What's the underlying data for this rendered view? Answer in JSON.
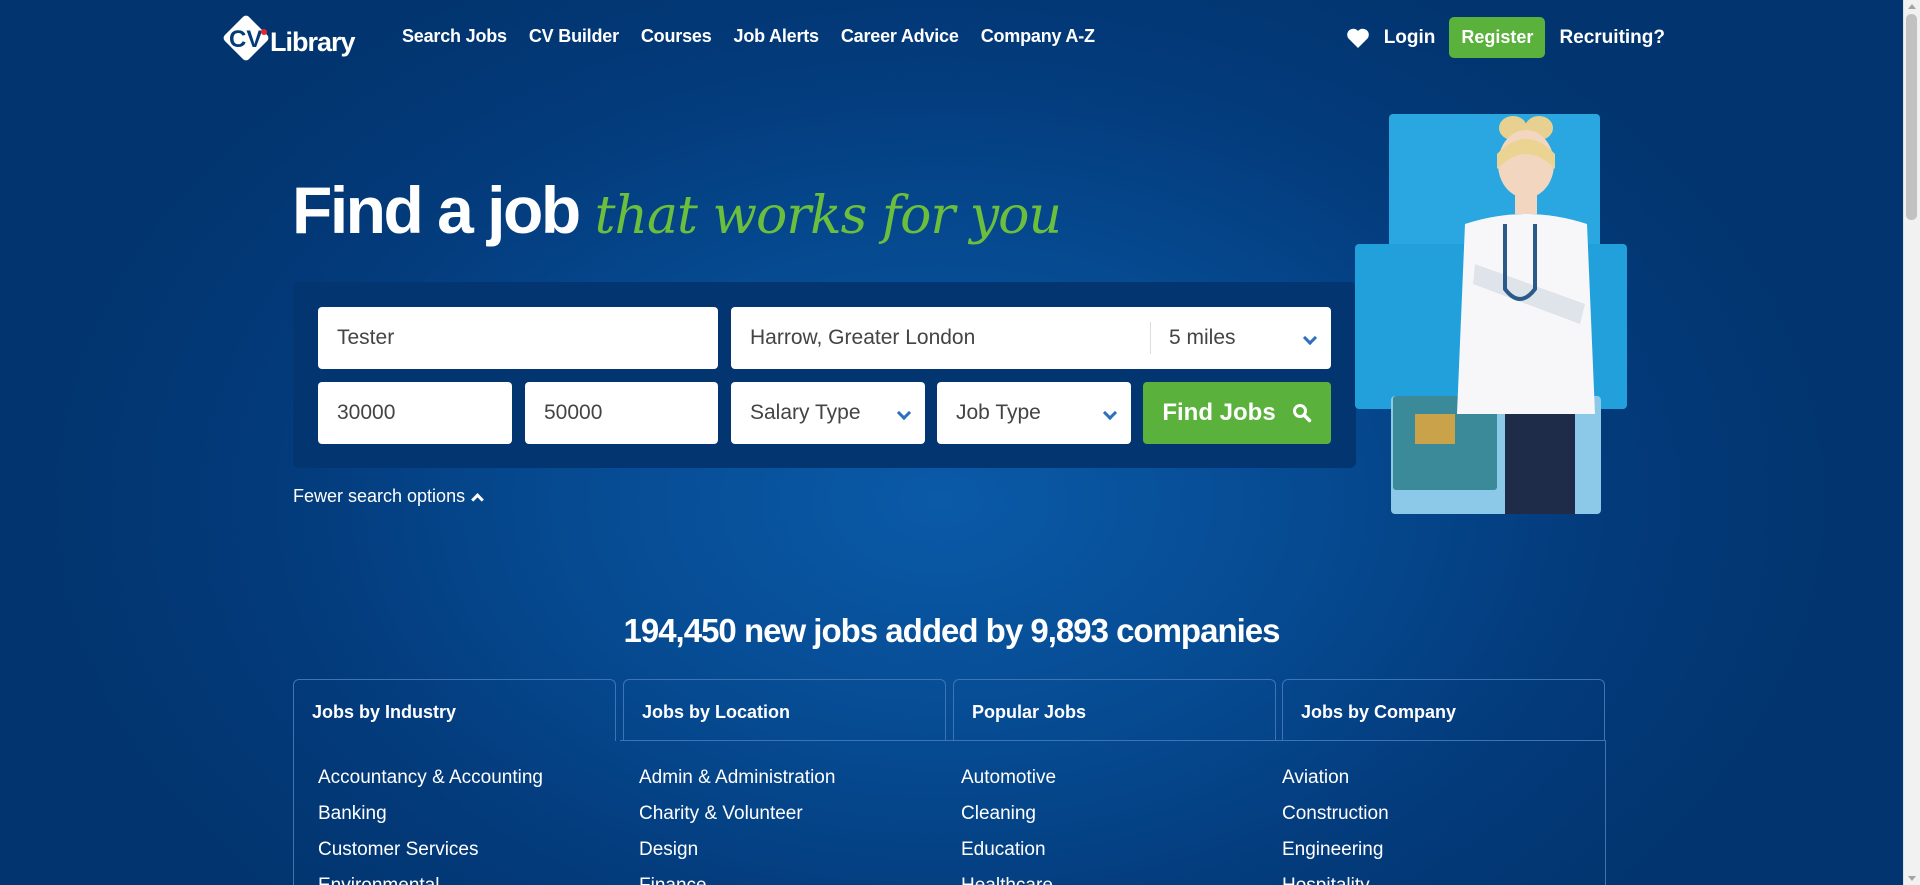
{
  "brand": {
    "logo_text": "CVLibrary",
    "accent": "#5ab13c",
    "bg": "#033a7a"
  },
  "nav": {
    "items": [
      "Search Jobs",
      "CV Builder",
      "Courses",
      "Job Alerts",
      "Career Advice",
      "Company A-Z"
    ]
  },
  "header": {
    "favourite_icon": "heart-icon",
    "login": "Login",
    "register": "Register",
    "recruiting": "Recruiting?"
  },
  "hero": {
    "title_main": "Find a job",
    "title_script": "that works for you"
  },
  "search": {
    "keyword": "Tester",
    "location": "Harrow, Greater London",
    "distance": "5 miles",
    "salary_min": "30000",
    "salary_max": "50000",
    "salary_type": "Salary Type",
    "job_type": "Job Type",
    "find_button": "Find Jobs",
    "fewer_options": "Fewer search options"
  },
  "stats": "194,450 new jobs added by 9,893 companies",
  "tabs": [
    "Jobs by Industry",
    "Jobs by Location",
    "Popular Jobs",
    "Jobs by Company"
  ],
  "columns": [
    [
      "Accountancy & Accounting",
      "Banking",
      "Customer Services",
      "Environmental"
    ],
    [
      "Admin & Administration",
      "Charity & Volunteer",
      "Design",
      "Finance"
    ],
    [
      "Automotive",
      "Cleaning",
      "Education",
      "Healthcare"
    ],
    [
      "Aviation",
      "Construction",
      "Engineering",
      "Hospitality"
    ]
  ]
}
